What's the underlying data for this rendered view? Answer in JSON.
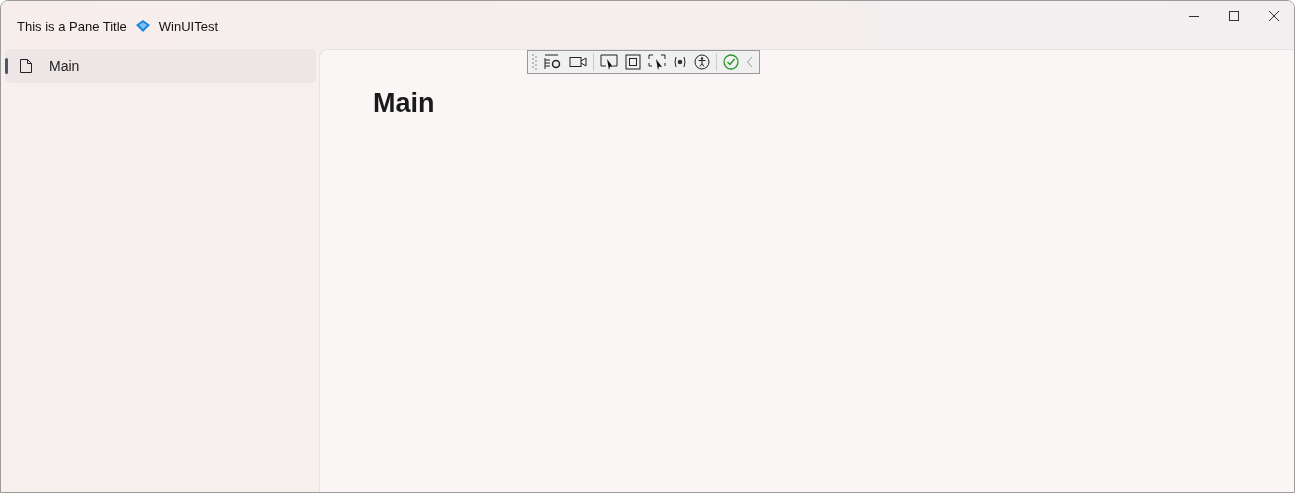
{
  "window": {
    "title": "This is a Pane Title",
    "app_name": "WinUITest"
  },
  "nav": {
    "items": [
      {
        "label": "Main",
        "selected": true
      }
    ]
  },
  "page": {
    "heading": "Main"
  }
}
